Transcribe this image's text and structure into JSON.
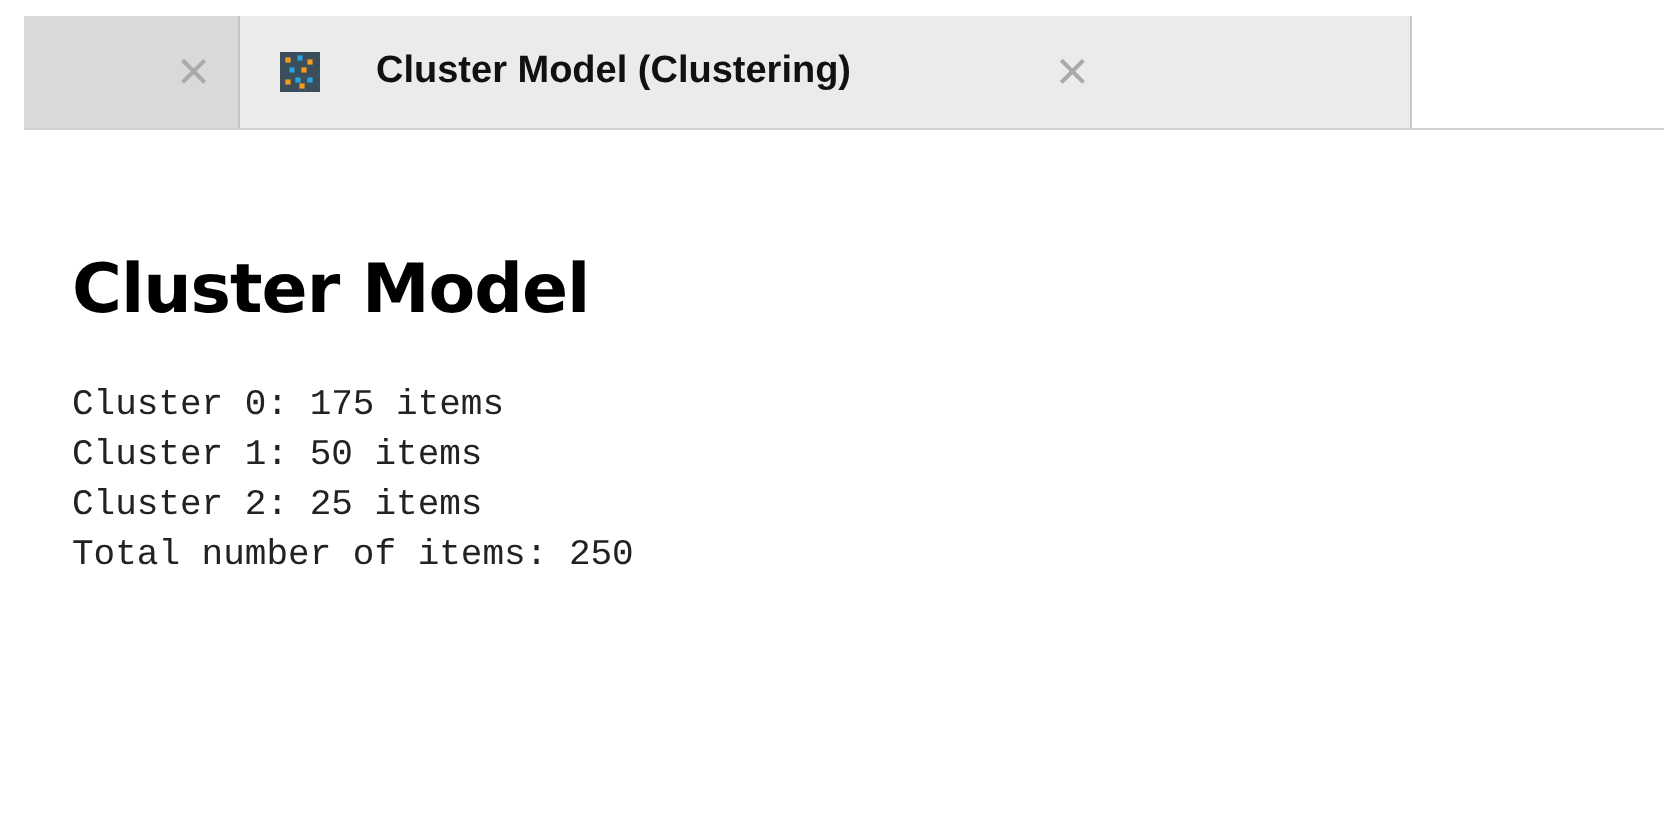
{
  "tabs": [
    {
      "close": "×",
      "selected": false
    },
    {
      "title": "Cluster Model (Clustering)",
      "close": "×",
      "selected": true
    }
  ],
  "heading": "Cluster Model",
  "lines": [
    "Cluster 0: 175 items",
    "Cluster 1: 50 items",
    "Cluster 2: 25 items",
    "Total number of items: 250"
  ]
}
